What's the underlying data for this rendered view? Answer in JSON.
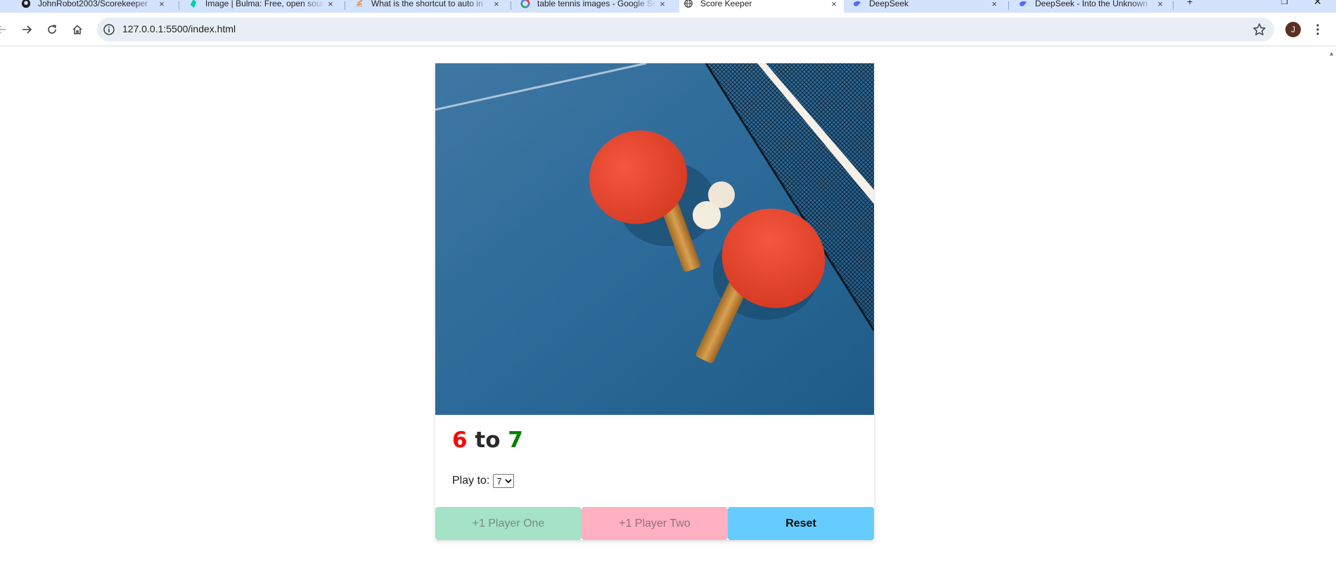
{
  "browser": {
    "tabs": [
      {
        "label": "JohnRobot2003/Scorekeeper",
        "icon": "github-icon",
        "close": "×",
        "active": false
      },
      {
        "label": "Image | Bulma: Free, open source",
        "icon": "bulma-icon",
        "close": "×",
        "active": false
      },
      {
        "label": "What is the shortcut to auto in",
        "icon": "stackoverflow-icon",
        "close": "×",
        "active": false
      },
      {
        "label": "table tennis images - Google Se",
        "icon": "google-icon",
        "close": "×",
        "active": false
      },
      {
        "label": "Score Keeper",
        "icon": "globe-icon",
        "close": "×",
        "active": true
      },
      {
        "label": "DeepSeek",
        "icon": "deepseek-icon",
        "close": "×",
        "active": false
      },
      {
        "label": "DeepSeek - Into the Unknown",
        "icon": "deepseek-icon",
        "close": "×",
        "active": false
      }
    ],
    "new_tab": "+",
    "url": "127.0.0.1:5500/index.html",
    "profile_initial": "J",
    "accent_color": "#d3e3fd"
  },
  "scorekeeper": {
    "image_alt": "",
    "score": {
      "player_one": "6",
      "separator": "to",
      "player_two": "7"
    },
    "play_to": {
      "label": "Play to:",
      "selected": "7"
    },
    "buttons": {
      "player_one": "+1 Player One",
      "player_two": "+1 Player Two",
      "reset": "Reset"
    },
    "colors": {
      "player_one_score": "#ff0000",
      "player_two_score": "#008000",
      "player_one_button": "#a4e3c7",
      "player_two_button": "#ffb0c1",
      "reset_button": "#66ccff"
    }
  }
}
